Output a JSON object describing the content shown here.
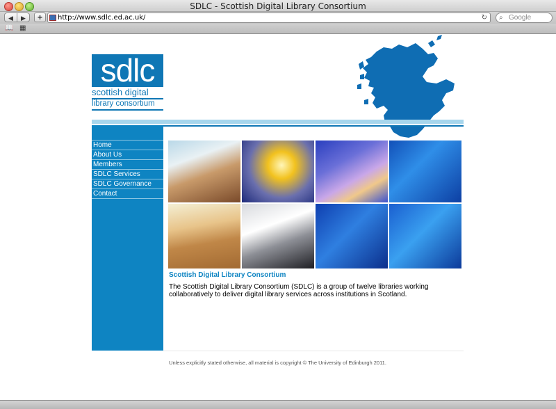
{
  "window": {
    "title": "SDLC - Scottish Digital Library Consortium"
  },
  "toolbar": {
    "back_icon": "◀",
    "forward_icon": "▶",
    "add_icon": "+",
    "url": "http://www.sdlc.ed.ac.uk/",
    "reload_icon": "↻",
    "search_icon": "⌕",
    "search_placeholder": "Google"
  },
  "bookmarks": {
    "book_icon": "📖",
    "grid_icon": "▦"
  },
  "logo": {
    "short": "sdlc",
    "line1": "scottish digital",
    "line2": "library consortium",
    "color": "#0f77b5"
  },
  "nav": {
    "items": [
      {
        "label": "Home"
      },
      {
        "label": "About Us"
      },
      {
        "label": "Members"
      },
      {
        "label": "SDLC Services"
      },
      {
        "label": "SDLC Governance"
      },
      {
        "label": "Contact"
      }
    ]
  },
  "content": {
    "title": "Scottish Digital Library Consortium",
    "body": "The Scottish Digital Library Consortium (SDLC) is a group of twelve libraries working collaboratively to deliver digital library services across institutions in Scotland."
  },
  "footer": {
    "text": "Unless explicitly stated otherwise, all material is copyright © The University of Edinburgh 2011."
  },
  "colors": {
    "brand_blue": "#0e84c2",
    "light_stripe": "#a7d6ec"
  }
}
